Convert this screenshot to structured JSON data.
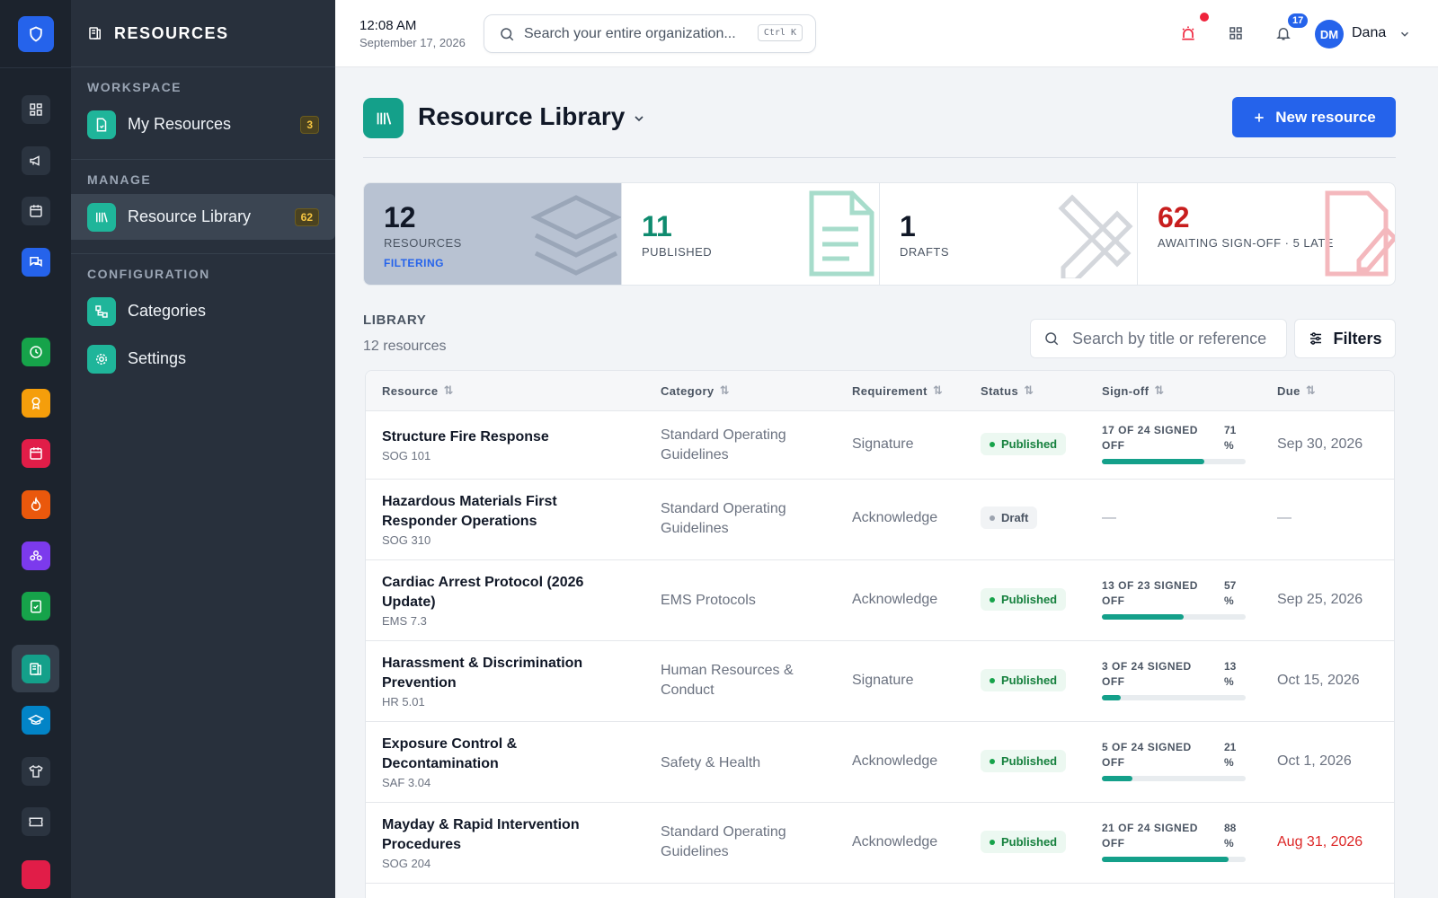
{
  "nav": {
    "title": "RESOURCES",
    "sections": {
      "workspace": "WORKSPACE",
      "manage": "MANAGE",
      "configuration": "CONFIGURATION"
    },
    "items": {
      "my_resources": {
        "label": "My Resources",
        "badge": "3"
      },
      "resource_library": {
        "label": "Resource Library",
        "badge": "62"
      },
      "categories": {
        "label": "Categories"
      },
      "settings": {
        "label": "Settings"
      }
    }
  },
  "topbar": {
    "time": "12:08 AM",
    "date": "September 17, 2026",
    "search_placeholder": "Search your entire organization...",
    "shortcut": "Ctrl K",
    "notification_count": "17",
    "user_initials": "DM",
    "user_name": "Dana"
  },
  "page": {
    "title": "Resource Library",
    "new_button": "New resource"
  },
  "stats": [
    {
      "value": "12",
      "label": "RESOURCES",
      "sub": "FILTERING"
    },
    {
      "value": "11",
      "label": "PUBLISHED"
    },
    {
      "value": "1",
      "label": "DRAFTS"
    },
    {
      "value": "62",
      "label": "AWAITING SIGN-OFF · 5 LATE"
    }
  ],
  "library": {
    "title": "LIBRARY",
    "count": "12 resources",
    "search_placeholder": "Search by title or reference",
    "filters_label": "Filters"
  },
  "table": {
    "columns": [
      "Resource",
      "Category",
      "Requirement",
      "Status",
      "Sign-off",
      "Due"
    ],
    "rows": [
      {
        "title": "Structure Fire Response",
        "code": "SOG 101",
        "category": "Standard Operating Guidelines",
        "requirement": "Signature",
        "status": "Published",
        "signoff": "17 OF 24 SIGNED OFF",
        "pct": "71 %",
        "progress": 0.71,
        "due": "Sep 30, 2026",
        "late": false
      },
      {
        "title": "Hazardous Materials First Responder Operations",
        "code": "SOG 310",
        "category": "Standard Operating Guidelines",
        "requirement": "Acknowledge",
        "status": "Draft",
        "signoff": "—",
        "pct": "",
        "progress": null,
        "due": "—",
        "late": false
      },
      {
        "title": "Cardiac Arrest Protocol (2026 Update)",
        "code": "EMS 7.3",
        "category": "EMS Protocols",
        "requirement": "Acknowledge",
        "status": "Published",
        "signoff": "13 OF 23 SIGNED OFF",
        "pct": "57 %",
        "progress": 0.57,
        "due": "Sep 25, 2026",
        "late": false
      },
      {
        "title": "Harassment & Discrimination Prevention",
        "code": "HR 5.01",
        "category": "Human Resources & Conduct",
        "requirement": "Signature",
        "status": "Published",
        "signoff": "3 OF 24 SIGNED OFF",
        "pct": "13 %",
        "progress": 0.13,
        "due": "Oct 15, 2026",
        "late": false
      },
      {
        "title": "Exposure Control & Decontamination",
        "code": "SAF 3.04",
        "category": "Safety & Health",
        "requirement": "Acknowledge",
        "status": "Published",
        "signoff": "5 OF 24 SIGNED OFF",
        "pct": "21 %",
        "progress": 0.21,
        "due": "Oct 1, 2026",
        "late": false
      },
      {
        "title": "Mayday & Rapid Intervention Procedures",
        "code": "SOG 204",
        "category": "Standard Operating Guidelines",
        "requirement": "Acknowledge",
        "status": "Published",
        "signoff": "21 OF 24 SIGNED OFF",
        "pct": "88 %",
        "progress": 0.88,
        "due": "Aug 31, 2026",
        "late": true
      }
    ]
  },
  "colors": {
    "accent": "#2563eb",
    "teal": "#14a08a",
    "late": "#dc2626",
    "alert_red": "#ef233c"
  }
}
